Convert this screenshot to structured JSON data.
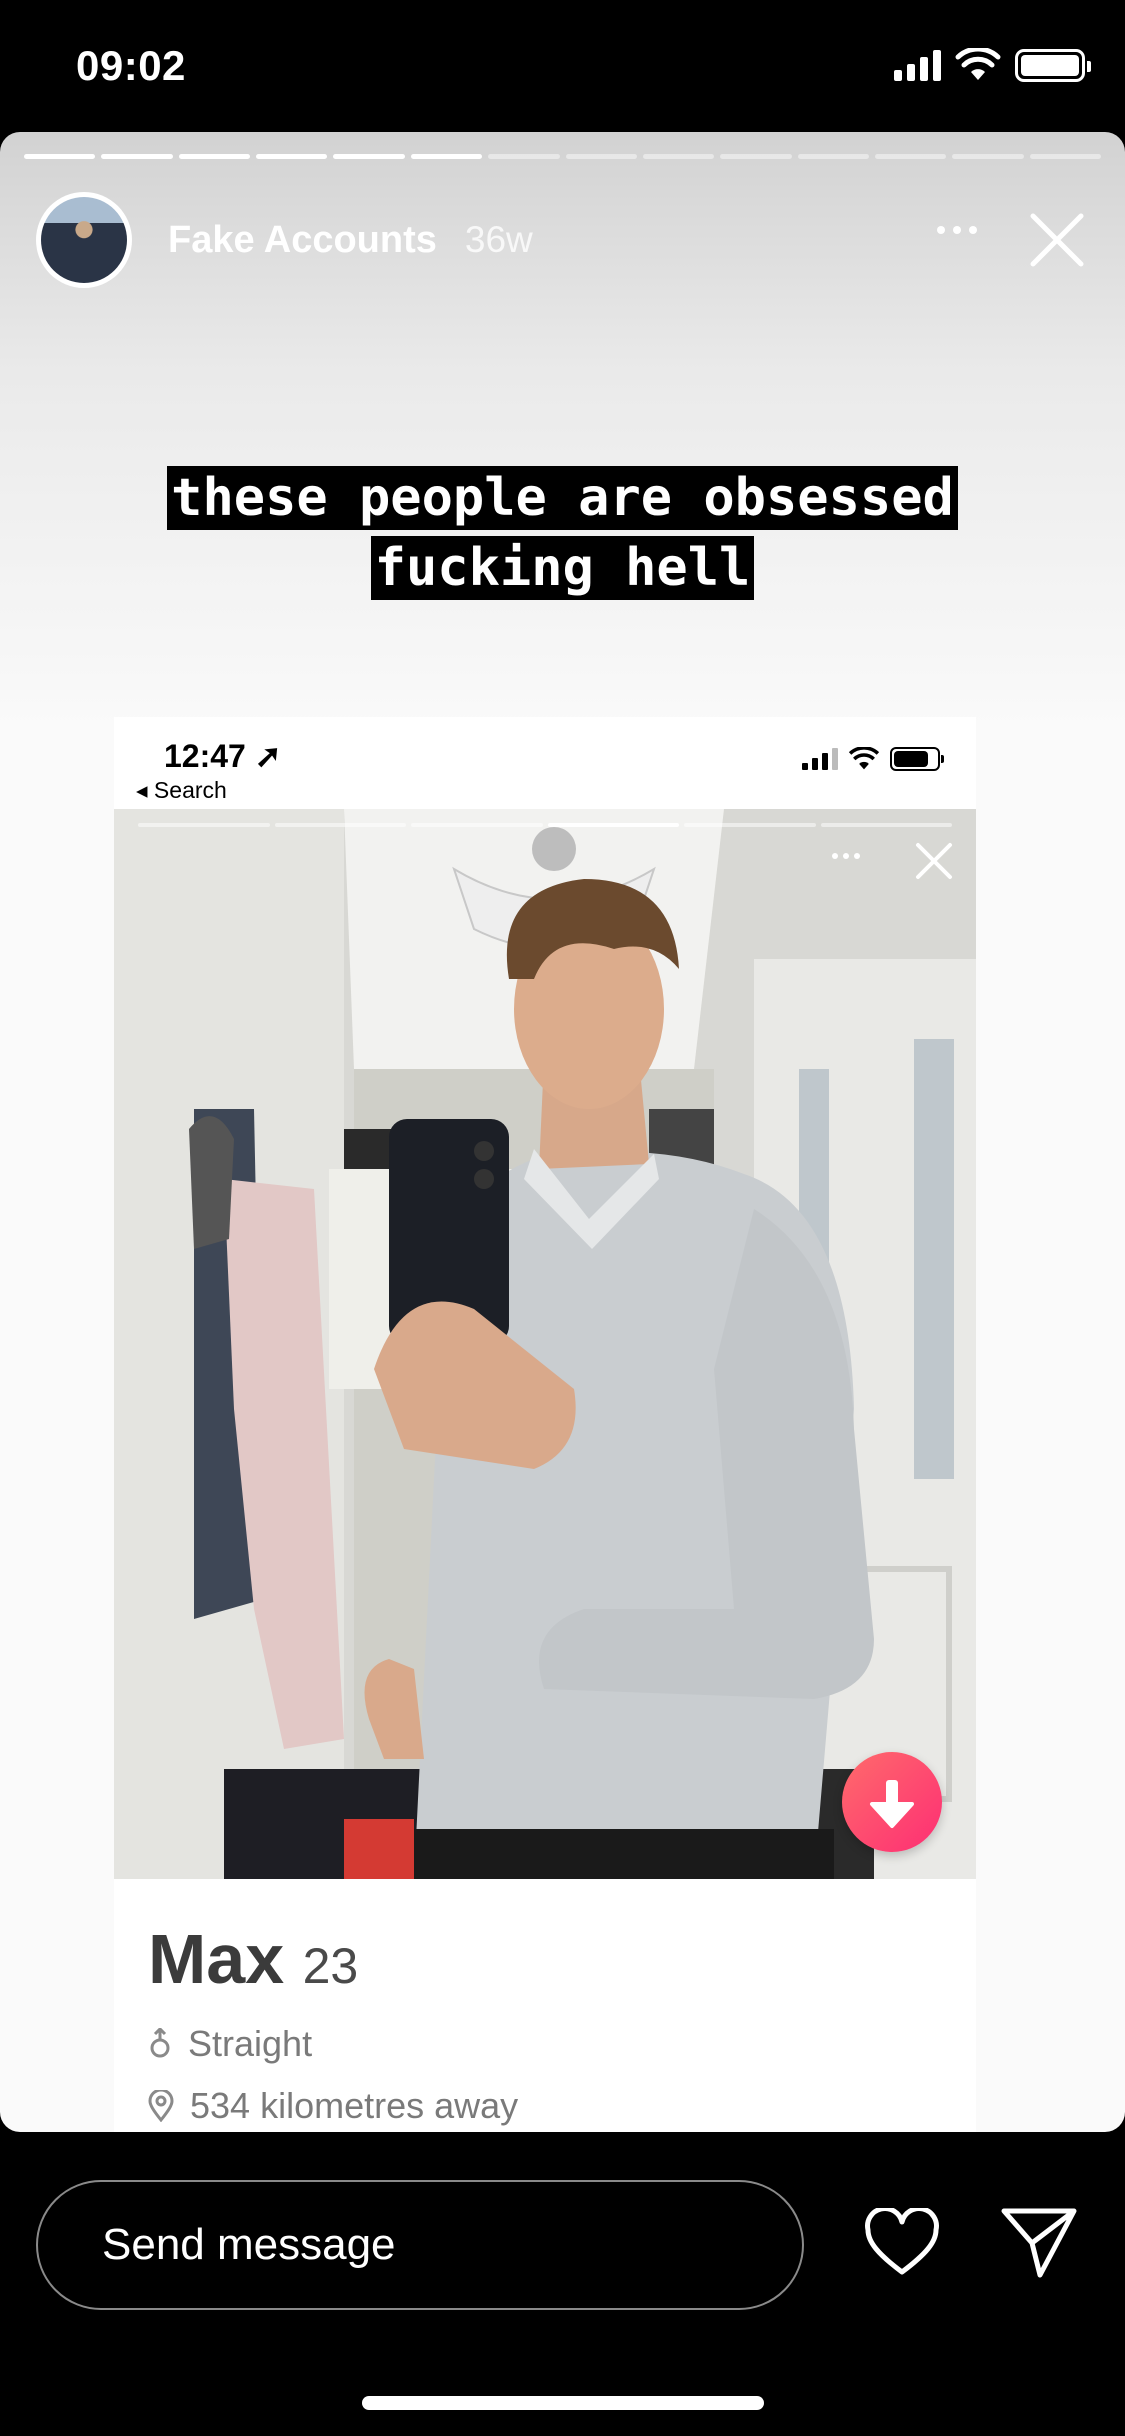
{
  "status_bar": {
    "time": "09:02"
  },
  "story": {
    "user": "Fake Accounts",
    "time_ago": "36w",
    "progress_total": 14,
    "progress_done": 6,
    "caption_lines": [
      "these people are obsessed",
      "fucking hell"
    ]
  },
  "embedded": {
    "status_time": "12:47",
    "back_label": "◂ Search",
    "profile": {
      "name": "Max",
      "age": "23",
      "orientation": "Straight",
      "distance": "534 kilometres away"
    }
  },
  "bottom_bar": {
    "message_placeholder": "Send message"
  },
  "icons": [
    "more-icon",
    "close-icon",
    "heart-icon",
    "send-icon",
    "arrow-down-icon",
    "location-pin-icon",
    "gender-icon"
  ]
}
